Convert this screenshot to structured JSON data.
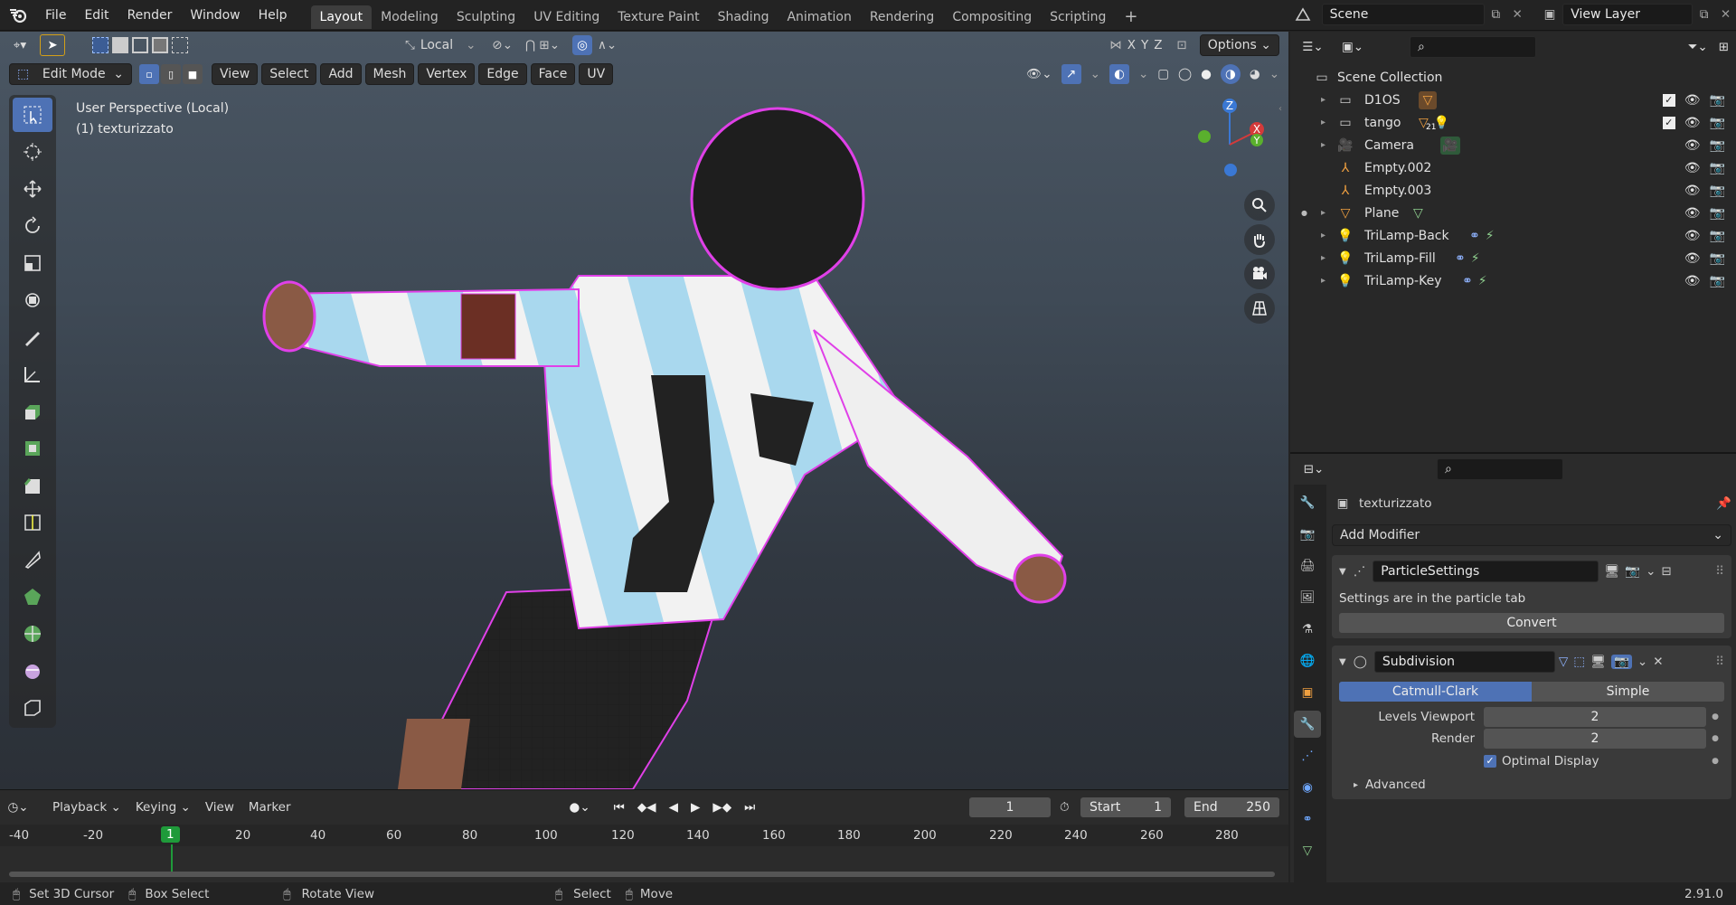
{
  "menu": [
    "File",
    "Edit",
    "Render",
    "Window",
    "Help"
  ],
  "workspaces": [
    "Layout",
    "Modeling",
    "Sculpting",
    "UV Editing",
    "Texture Paint",
    "Shading",
    "Animation",
    "Rendering",
    "Compositing",
    "Scripting"
  ],
  "active_workspace": "Layout",
  "scene": {
    "label": "Scene",
    "view_layer": "View Layer"
  },
  "header": {
    "transform_orientation": "Local",
    "options": "Options",
    "axes": [
      "X",
      "Y",
      "Z"
    ]
  },
  "viewport": {
    "mode": "Edit Mode",
    "menus": [
      "View",
      "Select",
      "Add",
      "Mesh",
      "Vertex",
      "Edge",
      "Face",
      "UV"
    ],
    "overlay_line1": "User Perspective (Local)",
    "overlay_line2": "(1) texturizzato",
    "gizmo_axes": {
      "z": "Z",
      "x": "X",
      "y": "Y"
    }
  },
  "timeline": {
    "menus": [
      "Playback",
      "Keying",
      "View",
      "Marker"
    ],
    "current_frame": "1",
    "start_label": "Start",
    "start": "1",
    "end_label": "End",
    "end": "250",
    "ruler": [
      "-40",
      "-20",
      "1",
      "20",
      "40",
      "60",
      "80",
      "100",
      "120",
      "140",
      "160",
      "180",
      "200",
      "220",
      "240",
      "260",
      "280"
    ]
  },
  "status": {
    "items": [
      "Set 3D Cursor",
      "Box Select",
      "Rotate View",
      "Select",
      "Move"
    ],
    "version": "2.91.0"
  },
  "outliner": {
    "root": "Scene Collection",
    "items": [
      {
        "name": "D1OS",
        "type": "collection",
        "checked": true
      },
      {
        "name": "tango",
        "type": "collection",
        "checked": true,
        "badge": "21"
      },
      {
        "name": "Camera",
        "type": "camera"
      },
      {
        "name": "Empty.002",
        "type": "empty"
      },
      {
        "name": "Empty.003",
        "type": "empty"
      },
      {
        "name": "Plane",
        "type": "mesh"
      },
      {
        "name": "TriLamp-Back",
        "type": "light"
      },
      {
        "name": "TriLamp-Fill",
        "type": "light"
      },
      {
        "name": "TriLamp-Key",
        "type": "light"
      }
    ]
  },
  "properties": {
    "object_name": "texturizzato",
    "add_modifier": "Add Modifier",
    "particle_modifier": "ParticleSettings",
    "particle_note": "Settings are in the particle tab",
    "convert": "Convert",
    "subdiv_modifier": "Subdivision",
    "subdiv_types": [
      "Catmull-Clark",
      "Simple"
    ],
    "levels_viewport_label": "Levels Viewport",
    "levels_viewport": "2",
    "render_label": "Render",
    "render": "2",
    "optimal_display": "Optimal Display",
    "advanced": "Advanced"
  },
  "colors": {
    "accent": "#4e72b5",
    "selected_frame": "#1f9a3a",
    "mesh_select": "#e040e8"
  }
}
